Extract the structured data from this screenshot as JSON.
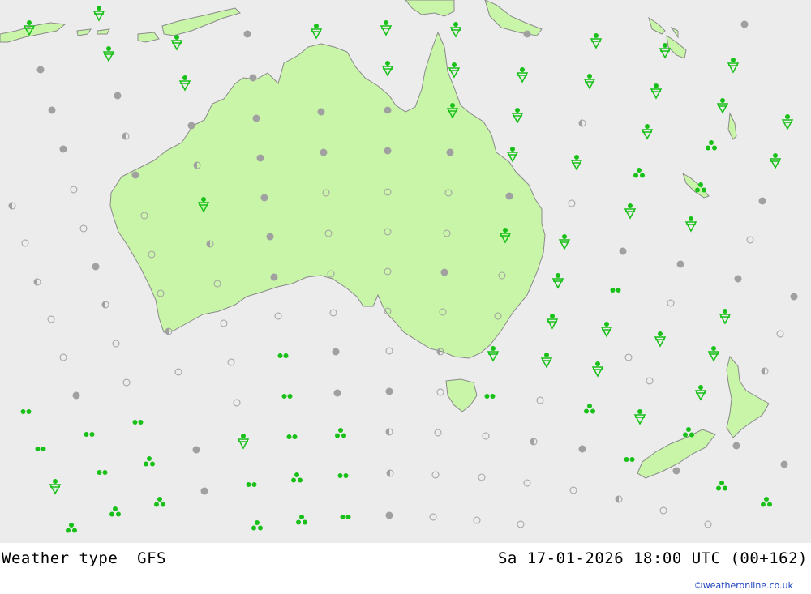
{
  "map": {
    "title": "Weather type",
    "model": "GFS",
    "datetime": "Sa 17-01-2026 18:00 UTC (00+162)",
    "credit": "©weatheronline.co.uk",
    "colors": {
      "sea": "#ececec",
      "land": "#c8f5a8",
      "coast": "#8a8a8a",
      "precip": "#18c018",
      "cloud": "#a0a0a0"
    },
    "legend_symbols": {
      "cloud": "grey filled dot = overcast",
      "partly": "half-filled circle = partly cloudy",
      "clear": "open circle = clear",
      "showers": "green triangle = showers",
      "drizzle": "double green dots = drizzle / light rain",
      "rain": "triple green dots = rain"
    }
  }
}
